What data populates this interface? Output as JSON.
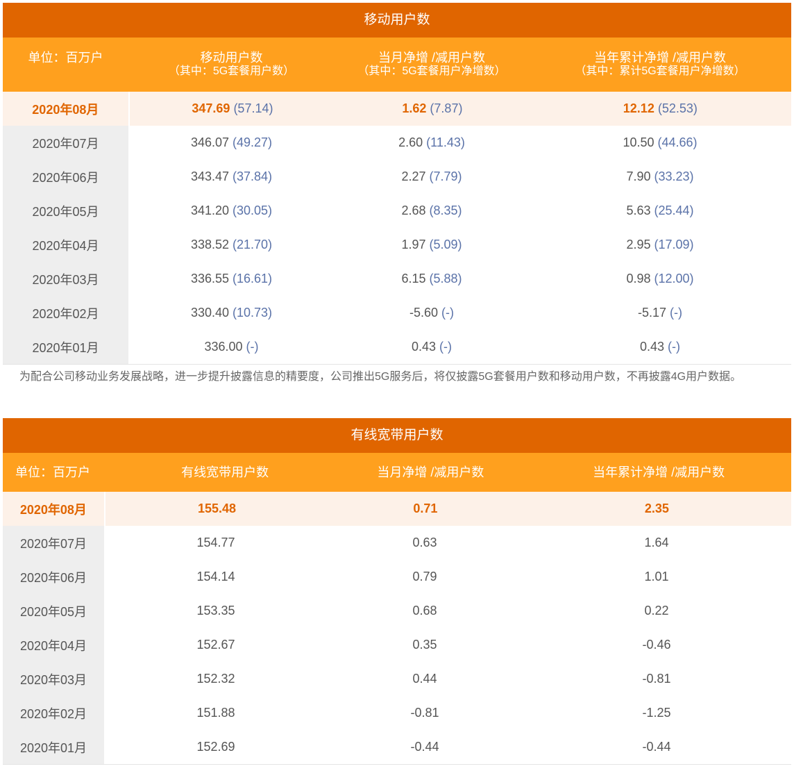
{
  "mobile": {
    "title": "移动用户数",
    "headers": {
      "unit": "单位：百万户",
      "col1": "移动用户数",
      "col1_sub": "（其中：5G套餐用户数）",
      "col2": "当月净增 /减用户数",
      "col2_sub": "（其中：5G套餐用户净增数）",
      "col3": "当年累计净增 /减用户数",
      "col3_sub": "（其中：累计5G套餐用户净增数）"
    },
    "rows": [
      {
        "month": "2020年08月",
        "v1": "347.69",
        "s1": "(57.14)",
        "v2": "1.62",
        "s2": "(7.87)",
        "v3": "12.12",
        "s3": "(52.53)"
      },
      {
        "month": "2020年07月",
        "v1": "346.07",
        "s1": "(49.27)",
        "v2": "2.60",
        "s2": "(11.43)",
        "v3": "10.50",
        "s3": "(44.66)"
      },
      {
        "month": "2020年06月",
        "v1": "343.47",
        "s1": "(37.84)",
        "v2": "2.27",
        "s2": "(7.79)",
        "v3": "7.90",
        "s3": "(33.23)"
      },
      {
        "month": "2020年05月",
        "v1": "341.20",
        "s1": "(30.05)",
        "v2": "2.68",
        "s2": "(8.35)",
        "v3": "5.63",
        "s3": "(25.44)"
      },
      {
        "month": "2020年04月",
        "v1": "338.52",
        "s1": "(21.70)",
        "v2": "1.97",
        "s2": "(5.09)",
        "v3": "2.95",
        "s3": "(17.09)"
      },
      {
        "month": "2020年03月",
        "v1": "336.55",
        "s1": "(16.61)",
        "v2": "6.15",
        "s2": "(5.88)",
        "v3": "0.98",
        "s3": "(12.00)"
      },
      {
        "month": "2020年02月",
        "v1": "330.40",
        "s1": "(10.73)",
        "v2": "-5.60",
        "s2": "(-)",
        "v3": "-5.17",
        "s3": "(-)"
      },
      {
        "month": "2020年01月",
        "v1": "336.00",
        "s1": "(-)",
        "v2": "0.43",
        "s2": "(-)",
        "v3": "0.43",
        "s3": "(-)"
      }
    ],
    "note": "为配合公司移动业务发展战略，进一步提升披露信息的精要度，公司推出5G服务后，将仅披露5G套餐用户数和移动用户数，不再披露4G用户数据。"
  },
  "broadband": {
    "title": "有线宽带用户数",
    "headers": {
      "unit": "单位：百万户",
      "col1": "有线宽带用户数",
      "col2": "当月净增 /减用户数",
      "col3": "当年累计净增 /减用户数"
    },
    "rows": [
      {
        "month": "2020年08月",
        "v1": "155.48",
        "v2": "0.71",
        "v3": "2.35"
      },
      {
        "month": "2020年07月",
        "v1": "154.77",
        "v2": "0.63",
        "v3": "1.64"
      },
      {
        "month": "2020年06月",
        "v1": "154.14",
        "v2": "0.79",
        "v3": "1.01"
      },
      {
        "month": "2020年05月",
        "v1": "153.35",
        "v2": "0.68",
        "v3": "0.22"
      },
      {
        "month": "2020年04月",
        "v1": "152.67",
        "v2": "0.35",
        "v3": "-0.46"
      },
      {
        "month": "2020年03月",
        "v1": "152.32",
        "v2": "0.44",
        "v3": "-0.81"
      },
      {
        "month": "2020年02月",
        "v1": "151.88",
        "v2": "-0.81",
        "v3": "-1.25"
      },
      {
        "month": "2020年01月",
        "v1": "152.69",
        "v2": "-0.44",
        "v3": "-0.44"
      }
    ]
  },
  "colors": {
    "title_bg": "#e06500",
    "header_bg": "#ffa01e",
    "highlight_text": "#e06500",
    "highlight_row_bg": "#fdf1e8",
    "month_col_bg": "#eeeeee",
    "sub_value": "#5a72a8"
  }
}
